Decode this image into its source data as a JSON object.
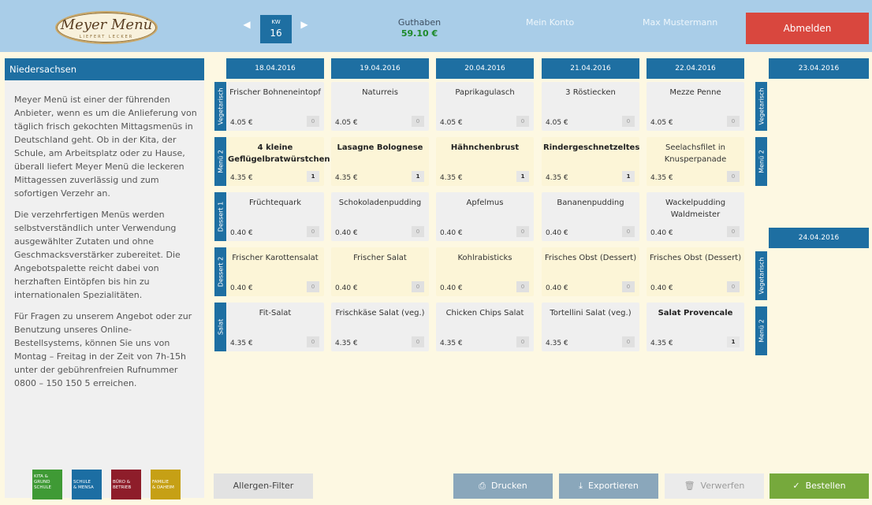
{
  "header": {
    "logo_text": "Meyer Menü",
    "logo_tagline": "LIEFERT LECKER",
    "kw_label": "KW",
    "kw_value": "16",
    "guthaben_label": "Guthaben",
    "guthaben_value": "59.10 €",
    "mein_konto": "Mein Konto",
    "user_name": "Max Mustermann",
    "logout": "Abmelden"
  },
  "sidebar": {
    "title": "Niedersachsen",
    "paragraphs": [
      "Meyer Menü ist einer der führenden Anbieter, wenn es um die Anlieferung von täglich frisch gekochten Mittagsmenüs in Deutschland geht. Ob in der Kita, der Schule, am Arbeitsplatz oder zu Hause, überall liefert Meyer Menü die leckeren Mittagessen zuverlässig und zum sofortigen Verzehr an.",
      "Die verzehrfertigen Menüs werden selbstverständlich unter Verwendung ausgewählter Zutaten und ohne Geschmacksverstärker zubereitet. Die Angebotspalette reicht dabei von herzhaften Eintöpfen bis hin zu internationalen Spezialitäten.",
      "Für Fragen zu unserem Angebot oder zur Benutzung unseres Online-Bestellsystems, können Sie uns von Montag – Freitag in der Zeit von 7h-15h unter der gebührenfreien Rufnummer 0800 – 150 150 5 erreichen."
    ],
    "icons": [
      {
        "l1": "KITA &",
        "l2": "GRUND",
        "l3": "SCHULE",
        "color": "#3f9a35"
      },
      {
        "l1": "",
        "l2": "SCHULE",
        "l3": "& MENSA",
        "color": "#1c6ea3"
      },
      {
        "l1": "",
        "l2": "BÜRO &",
        "l3": "BETRIEB",
        "color": "#8e1d2a"
      },
      {
        "l1": "",
        "l2": "FAMILIE",
        "l3": "& DAHEIM",
        "color": "#c6a015"
      }
    ]
  },
  "days": [
    "18.04.2016",
    "19.04.2016",
    "20.04.2016",
    "21.04.2016",
    "22.04.2016"
  ],
  "weekend": [
    "23.04.2016",
    "24.04.2016"
  ],
  "categories": [
    "Vegetarisch",
    "Menü 2",
    "Dessert 1",
    "Dessert 2",
    "Salat"
  ],
  "weekend_categories": [
    "Vegetarisch",
    "Menü 2",
    "Vegetarisch",
    "Menü 2"
  ],
  "rows": [
    [
      {
        "name": "Frischer Bohneneintopf",
        "price": "4.05 €",
        "qty": "0"
      },
      {
        "name": "Naturreis",
        "price": "4.05 €",
        "qty": "0"
      },
      {
        "name": "Paprikagulasch",
        "price": "4.05 €",
        "qty": "0"
      },
      {
        "name": "3 Röstiecken",
        "price": "4.05 €",
        "qty": "0"
      },
      {
        "name": "Mezze Penne",
        "price": "4.05 €",
        "qty": "0"
      }
    ],
    [
      {
        "name": "4 kleine Geflügelbratwürstchen",
        "price": "4.35 €",
        "qty": "1"
      },
      {
        "name": "Lasagne Bolognese",
        "price": "4.35 €",
        "qty": "1"
      },
      {
        "name": "Hähnchenbrust",
        "price": "4.35 €",
        "qty": "1"
      },
      {
        "name": "Rindergeschnetzeltes",
        "price": "4.35 €",
        "qty": "1"
      },
      {
        "name": "Seelachsfilet in Knusperpanade",
        "price": "4.35 €",
        "qty": "0"
      }
    ],
    [
      {
        "name": "Früchtequark",
        "price": "0.40 €",
        "qty": "0"
      },
      {
        "name": "Schokoladenpudding",
        "price": "0.40 €",
        "qty": "0"
      },
      {
        "name": "Apfelmus",
        "price": "0.40 €",
        "qty": "0"
      },
      {
        "name": "Bananenpudding",
        "price": "0.40 €",
        "qty": "0"
      },
      {
        "name": "Wackelpudding Waldmeister",
        "price": "0.40 €",
        "qty": "0"
      }
    ],
    [
      {
        "name": "Frischer Karottensalat",
        "price": "0.40 €",
        "qty": "0"
      },
      {
        "name": "Frischer Salat",
        "price": "0.40 €",
        "qty": "0"
      },
      {
        "name": "Kohlrabisticks",
        "price": "0.40 €",
        "qty": "0"
      },
      {
        "name": "Frisches Obst (Dessert)",
        "price": "0.40 €",
        "qty": "0"
      },
      {
        "name": "Frisches Obst (Dessert)",
        "price": "0.40 €",
        "qty": "0"
      }
    ],
    [
      {
        "name": "Fit-Salat",
        "price": "4.35 €",
        "qty": "0"
      },
      {
        "name": "Frischkäse Salat (veg.)",
        "price": "4.35 €",
        "qty": "0"
      },
      {
        "name": "Chicken Chips Salat",
        "price": "4.35 €",
        "qty": "0"
      },
      {
        "name": "Tortellini Salat (veg.)",
        "price": "4.35 €",
        "qty": "0"
      },
      {
        "name": "Salat Provencale",
        "price": "4.35 €",
        "qty": "1"
      }
    ]
  ],
  "footer": {
    "allergen": "Allergen-Filter",
    "drucken": "Drucken",
    "export": "Exportieren",
    "verwerfen": "Verwerfen",
    "bestellen": "Bestellen"
  },
  "colors": {
    "blue": "#1e6fa2",
    "green": "#76a93c",
    "red": "#d9473e",
    "highlight": "#fcf5d7"
  }
}
